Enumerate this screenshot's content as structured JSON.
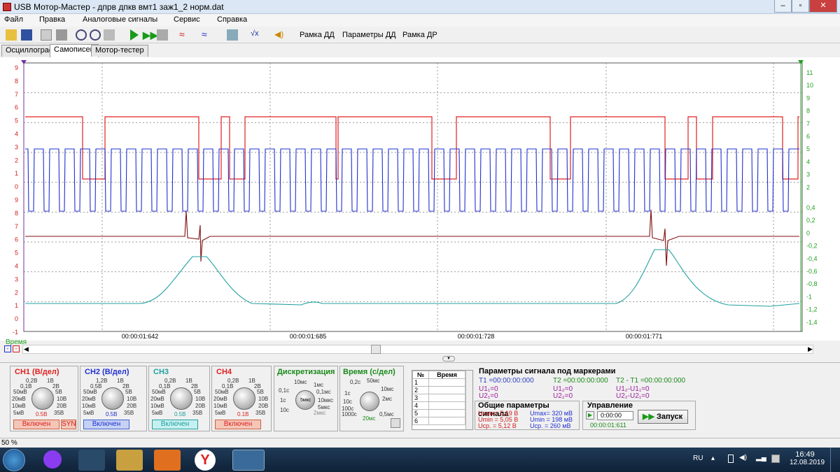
{
  "window": {
    "title": "USB Мотор-Мастер - дпрв дпкв вмт1 заж1_2 норм.dat"
  },
  "menu": [
    "Файл",
    "Правка",
    "Аналоговые сигналы",
    "Сервис",
    "Справка"
  ],
  "toolbar": {
    "btn_ramka_dd": "Рамка ДД",
    "btn_params_dd": "Параметры ДД",
    "btn_ramka_dr": "Рамка ДР"
  },
  "tabs": [
    "Осциллограф",
    "Самописец",
    "Мотор-тестер"
  ],
  "scope": {
    "time_label": "Время",
    "time_ticks": [
      "00:00:01:642",
      "00:00:01:685",
      "00:00:01:728",
      "00:00:01:771"
    ],
    "left_axis_ticks": [
      "9",
      "8",
      "7",
      "6",
      "5",
      "4",
      "3",
      "2",
      "1",
      "0",
      "9",
      "8",
      "7",
      "6",
      "5",
      "4",
      "3",
      "2",
      "1",
      "0",
      "-1"
    ],
    "right_axis_ch2": [
      "11",
      "10",
      "9",
      "8",
      "7",
      "6",
      "5",
      "4",
      "3",
      "2"
    ],
    "right_axis_ch3": [
      "0,4",
      "0,2",
      "0",
      "-0,2",
      "-0,4",
      "-0,6",
      "-0,8",
      "-1",
      "-1,2",
      "-1,4"
    ],
    "colors": {
      "ch1": "#e02020",
      "ch2": "#2030d0",
      "ch3": "#20a0a0",
      "ch4": "#801010",
      "right": "#20a020"
    }
  },
  "channels": [
    {
      "title": "CH1 (В/дел)",
      "color": "#e02020",
      "value": "0.5В",
      "button": "Включен",
      "extra": "SYN",
      "labels": [
        "0,2В",
        "1В",
        "0,1В",
        "2В",
        "50мВ",
        "5В",
        "20мВ",
        "10В",
        "10мВ",
        "20В",
        "5мВ",
        "35В"
      ]
    },
    {
      "title": "CH2 (В/дел)",
      "color": "#2030d0",
      "value": "0.5В",
      "button": "Включен",
      "labels": [
        "1,2В",
        "1В",
        "0,5В",
        "2В",
        "50мВ",
        "5В",
        "20мВ",
        "10В",
        "10мВ",
        "20В",
        "5мВ",
        "35В"
      ]
    },
    {
      "title": "CH3",
      "color": "#20a0a0",
      "value": "0.5В",
      "button": "Включен",
      "labels": [
        "0,2В",
        "1В",
        "0,1В",
        "2В",
        "50мВ",
        "5В",
        "20мВ",
        "10В",
        "10мВ",
        "20В",
        "5мВ",
        "35В"
      ]
    },
    {
      "title": "CH4",
      "color": "#e02020",
      "value": "0.1В",
      "button": "Включен",
      "labels": [
        "0,2В",
        "1В",
        "0,1В",
        "2В",
        "50мВ",
        "5В",
        "20мВ",
        "10В",
        "10мВ",
        "20В",
        "5мВ",
        "35В"
      ]
    }
  ],
  "sampling": {
    "title": "Дискретизация",
    "value": "5мкс",
    "labels": [
      "10мс",
      "1мс",
      "0,1с",
      "0,1мс",
      "1с",
      "10мкс",
      "10с",
      "5мкс",
      "2мкс"
    ]
  },
  "timediv": {
    "title": "Время (с/дел)",
    "value": "20мс",
    "labels": [
      "0,2с",
      "50мс",
      "1с",
      "10мс",
      "10с",
      "2мс",
      "100с",
      "1000с",
      "0,5мс"
    ]
  },
  "markers_table": {
    "headers": [
      "№",
      "Время"
    ],
    "rows": [
      "1",
      "2",
      "3",
      "4",
      "5",
      "6"
    ]
  },
  "marker_params": {
    "title": "Параметры сигнала под маркерами",
    "t1": "T1 =00:00:00:000",
    "t2": "T2 =00:00:00:000",
    "t21": "T2 - T1 =00:00:00:000",
    "u11": "U1₁=0",
    "u21": "U2₁=0",
    "u12": "U1₂=0",
    "u22": "U2₂=0",
    "du1": "U1₂-U1₁=0",
    "du2": "U2₂-U2₁=0"
  },
  "general_params": {
    "title": "Общие параметры сигнала",
    "ch1": [
      "Umax= 5,19 В",
      "Umin = 5,05 В",
      "Uср. = 5,12 В"
    ],
    "ch2": [
      "Umax= 320 мВ",
      "Umin = 198 мВ",
      "Uср. = 260 мВ"
    ]
  },
  "control": {
    "title": "Управление",
    "time": "0:00:00",
    "elapsed": "00:00:01:611",
    "start": "Запуск"
  },
  "status": {
    "zoom": "50 %"
  },
  "tray": {
    "lang": "RU",
    "time": "16:49",
    "date": "12.08.2019"
  }
}
